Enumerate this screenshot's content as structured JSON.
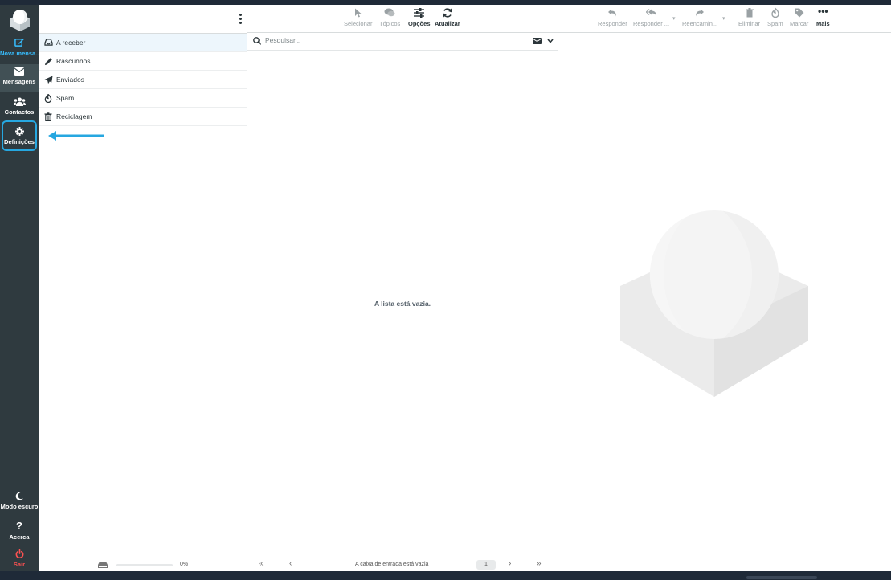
{
  "rail": {
    "compose_label": "Nova mensa...",
    "mail_label": "Mensagens",
    "contacts_label": "Contactos",
    "settings_label": "Definições",
    "dark_mode_label": "Modo escuro",
    "about_label": "Acerca",
    "logout_label": "Sair"
  },
  "folders": {
    "items": [
      {
        "label": "A receber",
        "icon": "inbox-icon"
      },
      {
        "label": "Rascunhos",
        "icon": "pencil-icon"
      },
      {
        "label": "Enviados",
        "icon": "paper-plane-icon"
      },
      {
        "label": "Spam",
        "icon": "fire-icon"
      },
      {
        "label": "Reciclagem",
        "icon": "trash-icon"
      }
    ],
    "quota": {
      "percent_label": "0%",
      "fraction": 0
    }
  },
  "list": {
    "toolbar": {
      "select_label": "Selecionar",
      "threads_label": "Tópicos",
      "options_label": "Opções",
      "refresh_label": "Atualizar"
    },
    "search_placeholder": "Pesquisar...",
    "empty_message": "A lista está vazia.",
    "footer": {
      "status": "A caixa de entrada está vazia",
      "page": "1"
    }
  },
  "reader": {
    "toolbar": {
      "reply_label": "Responder",
      "reply_all_label": "Responder ...",
      "forward_label": "Reencamin...",
      "delete_label": "Eliminar",
      "spam_label": "Spam",
      "mark_label": "Marcar",
      "more_label": "Mais"
    }
  },
  "colors": {
    "accent": "#37beff",
    "rail_bg": "#2f3a3f",
    "logout": "#ff5252",
    "highlight_border": "#26a7e0"
  }
}
